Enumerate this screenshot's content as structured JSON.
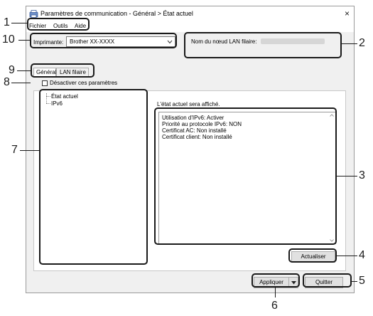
{
  "window": {
    "title": "Paramètres de communication - Général > État actuel",
    "close_glyph": "×"
  },
  "menu": {
    "items": [
      {
        "label": "Fichier"
      },
      {
        "label": "Outils"
      },
      {
        "label": "Aide"
      }
    ]
  },
  "printer": {
    "label": "Imprimante:",
    "value": "Brother  XX-XXXX"
  },
  "node": {
    "label": "Nom du nœud LAN filaire:"
  },
  "tabs": [
    {
      "label": "Général"
    },
    {
      "label": "LAN filaire"
    }
  ],
  "disable_checkbox": {
    "label": "Désactiver ces paramètres"
  },
  "tree": {
    "items": [
      {
        "label": "État actuel"
      },
      {
        "label": "IPv6"
      }
    ]
  },
  "status": {
    "heading": "L'état actuel sera affiché.",
    "lines": [
      "Utilisation d'IPv6: Activer",
      "Priorité au protocole IPv6: NON",
      "Certificat AC: Non installé",
      "Certificat client: Non installé"
    ]
  },
  "buttons": {
    "refresh": "Actualiser",
    "apply": "Appliquer",
    "quit": "Quitter"
  },
  "callouts": [
    "1",
    "2",
    "3",
    "4",
    "5",
    "6",
    "7",
    "8",
    "9",
    "10"
  ]
}
